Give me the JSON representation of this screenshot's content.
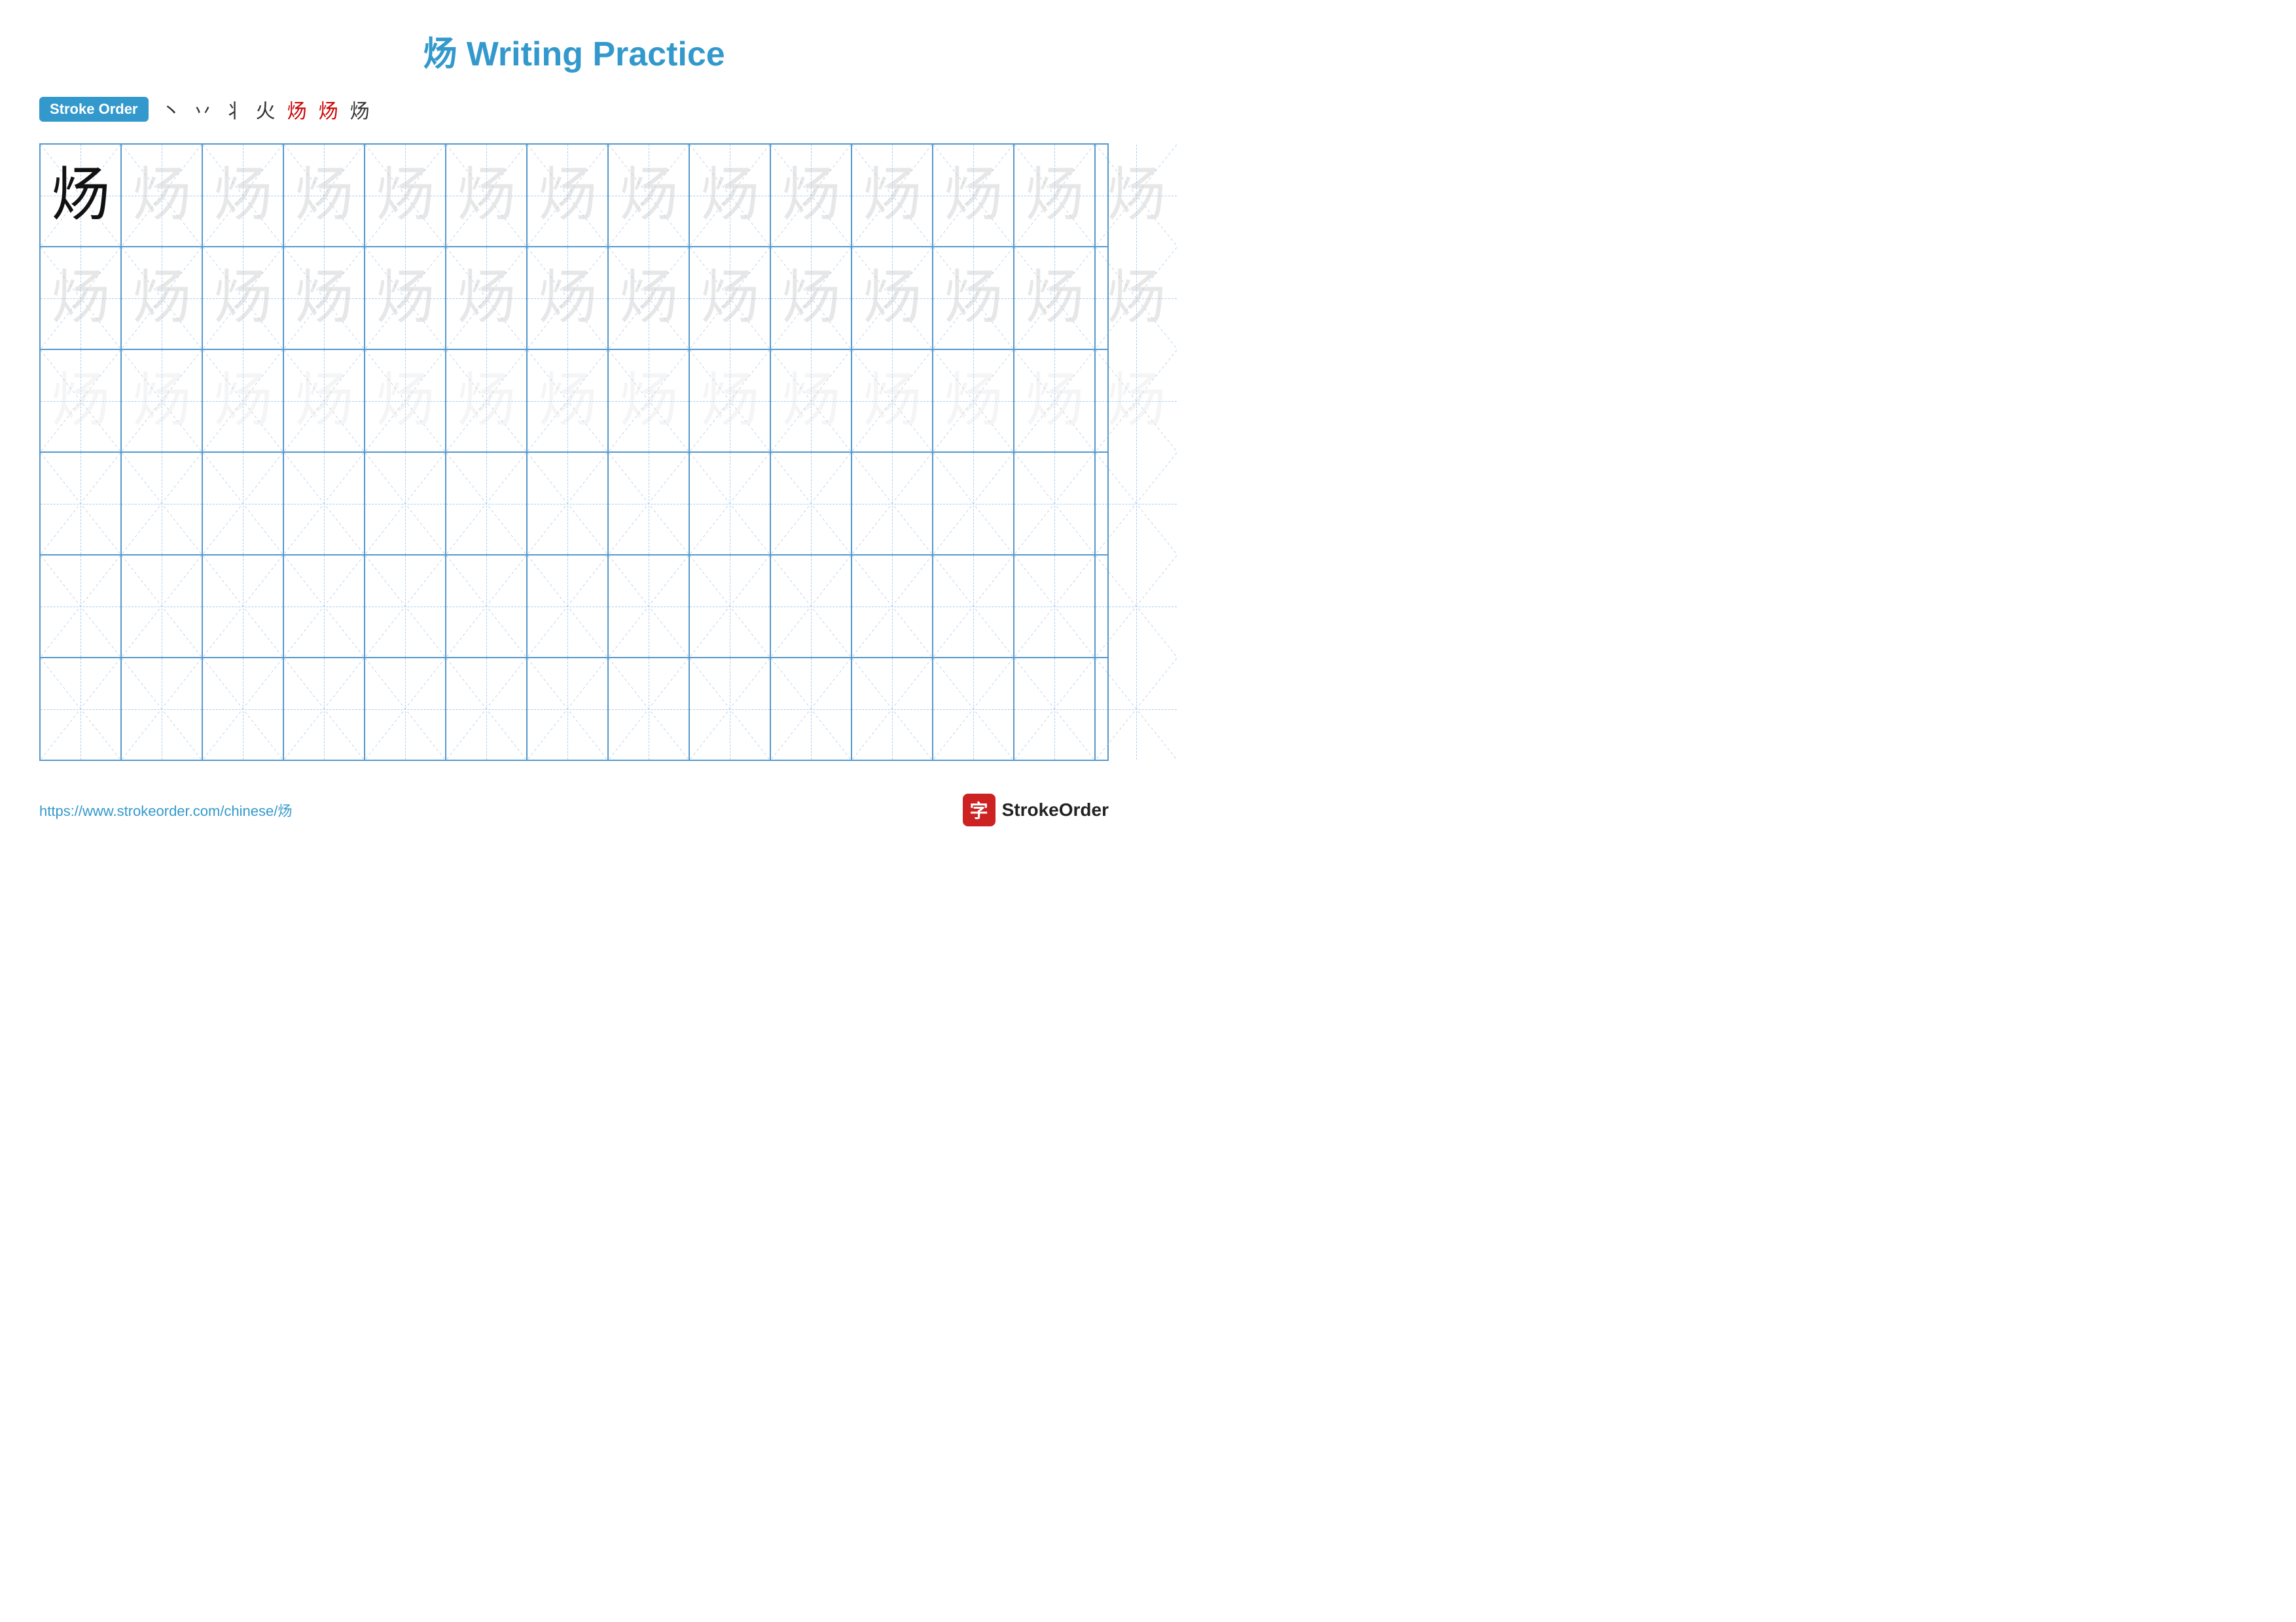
{
  "page": {
    "title": "炀 Writing Practice",
    "url": "https://www.strokeorder.com/chinese/炀"
  },
  "stroke_order": {
    "badge_label": "Stroke Order",
    "steps": [
      "丶",
      "丷",
      "丬",
      "火",
      "炀",
      "炀",
      "炀"
    ]
  },
  "grid": {
    "rows": 6,
    "cols": 14,
    "character": "炀",
    "row_styles": [
      [
        "dark",
        "light",
        "light",
        "light",
        "light",
        "light",
        "light",
        "light",
        "light",
        "light",
        "light",
        "light",
        "light",
        "light"
      ],
      [
        "light",
        "light",
        "light",
        "light",
        "light",
        "light",
        "light",
        "light",
        "light",
        "light",
        "light",
        "light",
        "light",
        "light"
      ],
      [
        "lighter",
        "lighter",
        "lighter",
        "lighter",
        "lighter",
        "lighter",
        "lighter",
        "lighter",
        "lighter",
        "lighter",
        "lighter",
        "lighter",
        "lighter",
        "lighter"
      ],
      [
        "none",
        "none",
        "none",
        "none",
        "none",
        "none",
        "none",
        "none",
        "none",
        "none",
        "none",
        "none",
        "none",
        "none"
      ],
      [
        "none",
        "none",
        "none",
        "none",
        "none",
        "none",
        "none",
        "none",
        "none",
        "none",
        "none",
        "none",
        "none",
        "none"
      ],
      [
        "none",
        "none",
        "none",
        "none",
        "none",
        "none",
        "none",
        "none",
        "none",
        "none",
        "none",
        "none",
        "none",
        "none"
      ]
    ]
  },
  "footer": {
    "logo_char": "字",
    "logo_text": "StrokeOrder"
  }
}
